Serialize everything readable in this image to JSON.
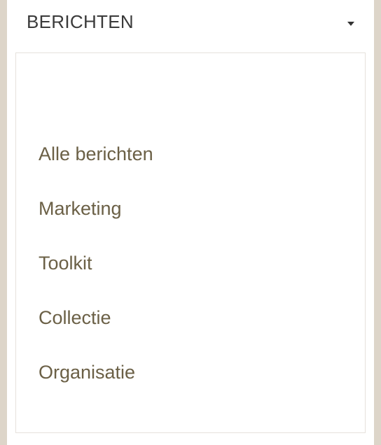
{
  "header": {
    "title": "BERICHTEN",
    "toggle_icon": "caret-down-icon"
  },
  "menu": {
    "items": [
      {
        "label": "Alle berichten"
      },
      {
        "label": "Marketing"
      },
      {
        "label": "Toolkit"
      },
      {
        "label": "Collectie"
      },
      {
        "label": "Organisatie"
      }
    ]
  },
  "colors": {
    "background": "#ddd5c9",
    "panel": "#ffffff",
    "link_text": "#6b6046",
    "header_text": "#3a3a3a",
    "border": "#e6e2dc"
  }
}
